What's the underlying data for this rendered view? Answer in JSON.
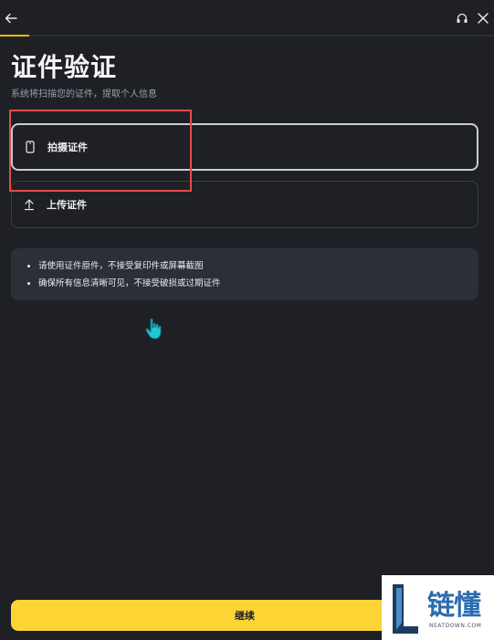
{
  "header": {
    "back_icon": "arrow-left-icon",
    "support_icon": "headset-icon",
    "close_icon": "close-icon",
    "progress_fraction": 0.06,
    "accent_color": "#f0b90b"
  },
  "page": {
    "title": "证件验证",
    "subtitle": "系统将扫描您的证件，提取个人信息"
  },
  "options": [
    {
      "label": "拍摄证件",
      "icon": "phone-icon",
      "selected": true
    },
    {
      "label": "上传证件",
      "icon": "upload-icon",
      "selected": false
    }
  ],
  "notice": {
    "items": [
      "请使用证件原件，不接受复印件或屏幕截图",
      "确保所有信息清晰可见，不接受破损或过期证件"
    ]
  },
  "footer": {
    "continue_label": "继续",
    "button_color": "#fcd535"
  },
  "watermark": {
    "text": "链懂",
    "sub": "NEATDOWN.COM"
  }
}
